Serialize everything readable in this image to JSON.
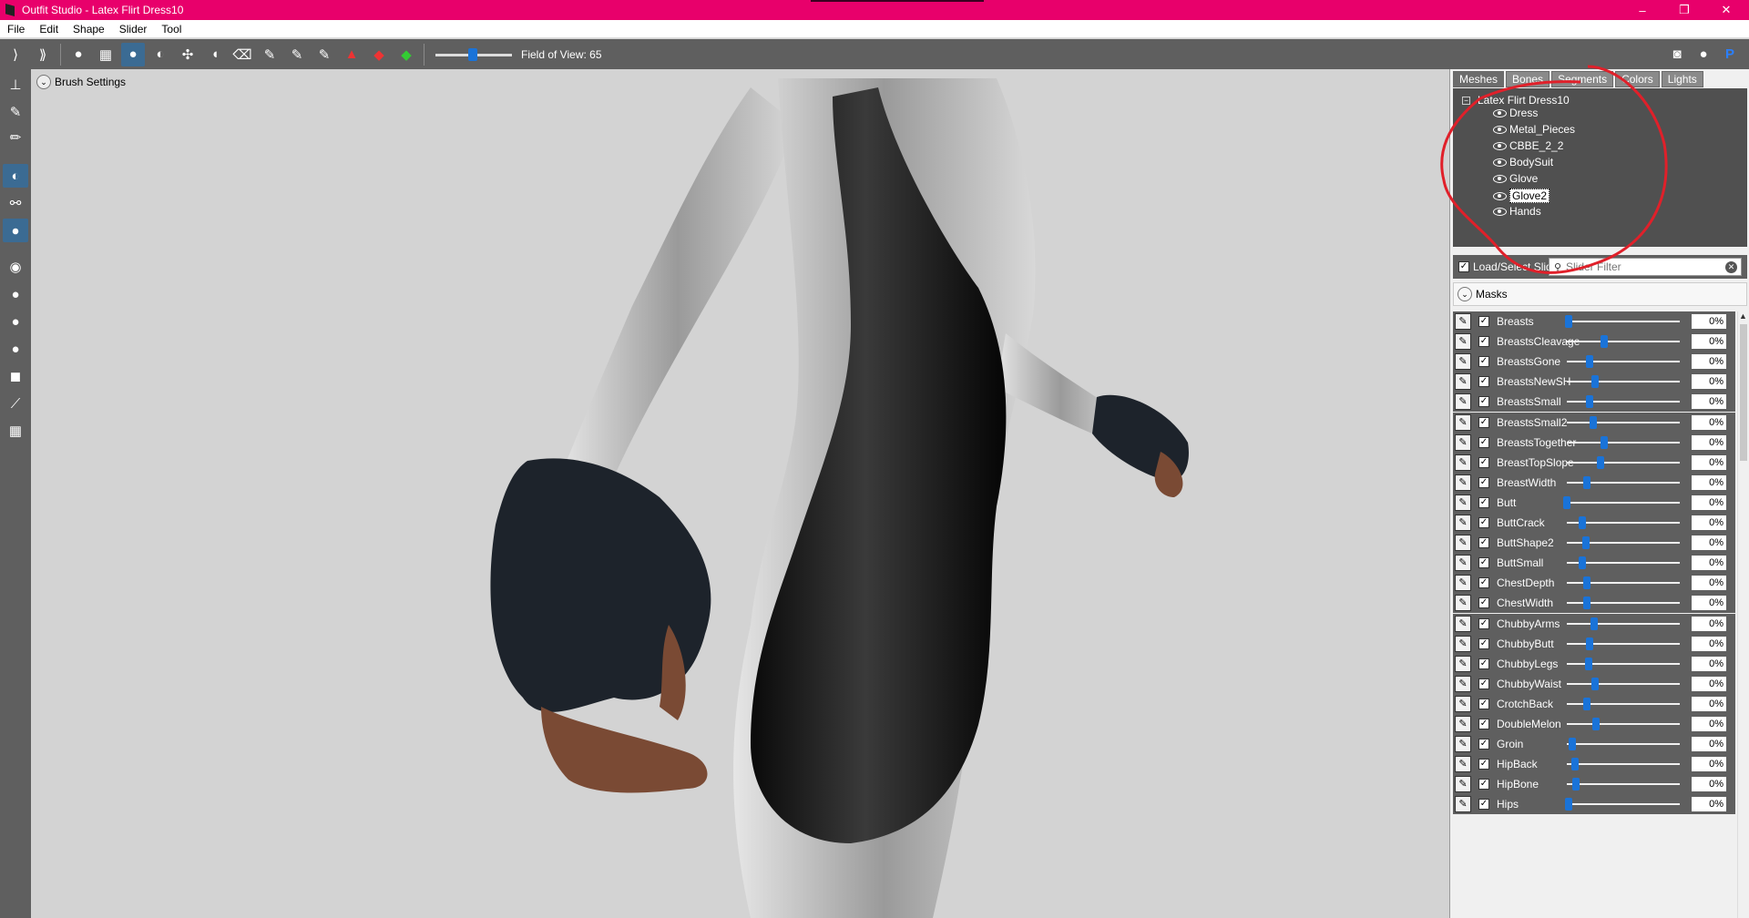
{
  "window": {
    "title": "Outfit Studio - Latex Flirt Dress10",
    "minimize": "–",
    "restore": "❐",
    "close": "✕"
  },
  "menu": [
    "File",
    "Edit",
    "Shape",
    "Slider",
    "Tool"
  ],
  "toolbar": {
    "fov_label": "Field of View: 65",
    "fov_value": 65,
    "active_tool": "inflate-brush-icon",
    "icons": [
      "select-icon",
      "transform-icon",
      "mask-brush-icon",
      "inflate-brush-icon",
      "deflate-brush-icon",
      "move-brush-icon",
      "smooth-brush-icon",
      "undiff-brush-icon",
      "weight-brush-icon",
      "color-brush-icon",
      "alpha-brush-icon",
      "collapse-vertex-icon",
      "flip-edge-icon",
      "split-edge-icon"
    ],
    "right_icons": [
      "discord-icon",
      "github-icon",
      "paypal-icon"
    ]
  },
  "left_tools": {
    "icons": [
      "axes-icon",
      "pin-icon",
      "pencil-icon",
      "xmirror-icon",
      "connected-icon",
      "global-brush-icon",
      "vertex-color-icon",
      "dot-icon",
      "dot-icon",
      "dot-icon",
      "cube-icon",
      "bone-icon",
      "grid-icon"
    ],
    "active": [
      "xmirror-icon",
      "global-brush-icon"
    ]
  },
  "viewport": {
    "brush_settings": "Brush Settings"
  },
  "panel": {
    "tabs": [
      {
        "label": "Meshes",
        "active": true
      },
      {
        "label": "Bones",
        "active": false
      },
      {
        "label": "Segments",
        "active": false
      },
      {
        "label": "Colors",
        "active": false
      },
      {
        "label": "Lights",
        "active": false
      }
    ],
    "tree_root": "Latex Flirt Dress10",
    "meshes": [
      "Dress",
      "Metal_Pieces",
      "CBBE_2_2",
      "BodySuit",
      "Glove",
      "Glove2",
      "Hands"
    ],
    "selected_mesh": "Glove2",
    "slider_header_label": "Load/Select Sliders",
    "slider_header_checked": true,
    "filter_placeholder": "Slider Filter",
    "masks_label": "Masks"
  },
  "sliders": [
    {
      "name": "Breasts",
      "value": "0%",
      "pos": 0.02
    },
    {
      "name": "BreastsCleavage",
      "value": "0%",
      "pos": 0.33
    },
    {
      "name": "BreastsGone",
      "value": "0%",
      "pos": 0.2
    },
    {
      "name": "BreastsNewSH",
      "value": "0%",
      "pos": 0.25
    },
    {
      "name": "BreastsSmall",
      "value": "0%",
      "pos": 0.2
    },
    {
      "name": "BreastsSmall2",
      "value": "0%",
      "pos": 0.23
    },
    {
      "name": "BreastsTogether",
      "value": "0%",
      "pos": 0.33
    },
    {
      "name": "BreastTopSlope",
      "value": "0%",
      "pos": 0.3
    },
    {
      "name": "BreastWidth",
      "value": "0%",
      "pos": 0.18
    },
    {
      "name": "Butt",
      "value": "0%",
      "pos": 0.0
    },
    {
      "name": "ButtCrack",
      "value": "0%",
      "pos": 0.14
    },
    {
      "name": "ButtShape2",
      "value": "0%",
      "pos": 0.17
    },
    {
      "name": "ButtSmall",
      "value": "0%",
      "pos": 0.14
    },
    {
      "name": "ChestDepth",
      "value": "0%",
      "pos": 0.18
    },
    {
      "name": "ChestWidth",
      "value": "0%",
      "pos": 0.18
    },
    {
      "name": "ChubbyArms",
      "value": "0%",
      "pos": 0.24
    },
    {
      "name": "ChubbyButt",
      "value": "0%",
      "pos": 0.2
    },
    {
      "name": "ChubbyLegs",
      "value": "0%",
      "pos": 0.19
    },
    {
      "name": "ChubbyWaist",
      "value": "0%",
      "pos": 0.25
    },
    {
      "name": "CrotchBack",
      "value": "0%",
      "pos": 0.18
    },
    {
      "name": "DoubleMelon",
      "value": "0%",
      "pos": 0.26
    },
    {
      "name": "Groin",
      "value": "0%",
      "pos": 0.05
    },
    {
      "name": "HipBack",
      "value": "0%",
      "pos": 0.07
    },
    {
      "name": "HipBone",
      "value": "0%",
      "pos": 0.08
    },
    {
      "name": "Hips",
      "value": "0%",
      "pos": 0.02
    }
  ],
  "colors": {
    "titlebar": "#e8006b",
    "toolbar": "#5f5f5f",
    "accent": "#1a73d8",
    "annotation": "#e0202a"
  }
}
